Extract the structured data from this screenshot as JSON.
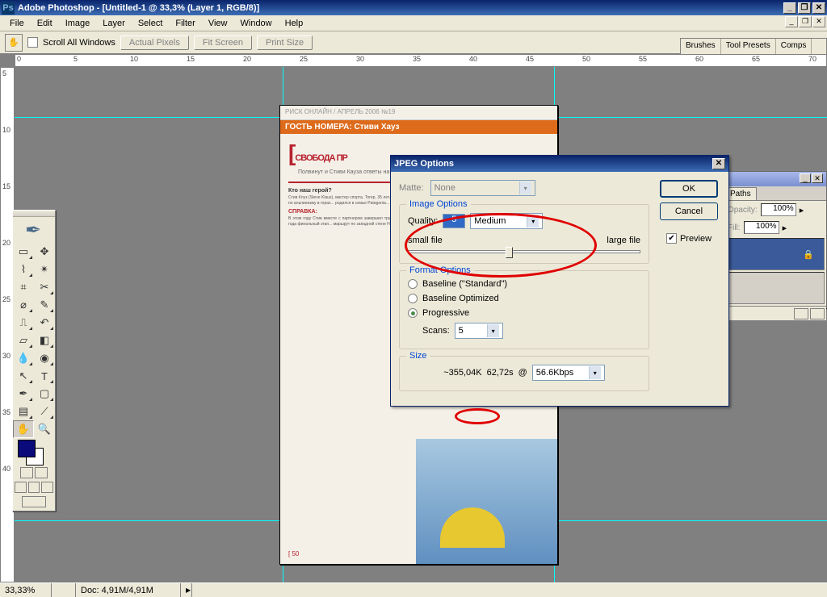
{
  "titlebar": {
    "app_icon_letter": "Ps",
    "title": "Adobe Photoshop - [Untitled-1 @ 33,3% (Layer 1, RGB/8)]"
  },
  "menu": [
    "File",
    "Edit",
    "Image",
    "Layer",
    "Select",
    "Filter",
    "View",
    "Window",
    "Help"
  ],
  "options": {
    "scroll_all": "Scroll All Windows",
    "actual_pixels": "Actual Pixels",
    "fit_screen": "Fit Screen",
    "print_size": "Print Size"
  },
  "ruler_h": [
    "0",
    "5",
    "10",
    "15",
    "20",
    "25",
    "30",
    "35",
    "40",
    "45",
    "50",
    "55",
    "60",
    "65",
    "70"
  ],
  "ruler_v": [
    "5",
    "10",
    "15",
    "20",
    "25",
    "30",
    "35",
    "40"
  ],
  "palette_well": [
    "Brushes",
    "Tool Presets",
    "Comps"
  ],
  "right_panel": {
    "tab": "Paths",
    "opacity_label": "Opacity:",
    "opacity_value": "100%",
    "fill_label": "Fill:",
    "fill_value": "100%"
  },
  "document": {
    "header": "РИСК ОНЛАЙН / АПРЕЛЬ 2006 №19",
    "section": "ГОСТЬ НОМЕРА: Стиви Хауз",
    "title": "СВОБОДА ПР",
    "subtitle": "Полвинут и Стиви Кауза ответы на вопросы...",
    "who_heading": "Кто наш герой?",
    "ref_heading": "СПРАВКА:",
    "footer": "[ 50"
  },
  "dialog": {
    "title": "JPEG Options",
    "ok": "OK",
    "cancel": "Cancel",
    "preview": "Preview",
    "matte_label": "Matte:",
    "matte_value": "None",
    "image_options": "Image Options",
    "quality_label": "Quality:",
    "quality_value": "5",
    "quality_preset": "Medium",
    "small_file": "small file",
    "large_file": "large file",
    "format_options": "Format Options",
    "baseline_standard": "Baseline (\"Standard\")",
    "baseline_optimized": "Baseline Optimized",
    "progressive": "Progressive",
    "scans_label": "Scans:",
    "scans_value": "5",
    "size_legend": "Size",
    "size_est": "~355,04K",
    "size_time": "62,72s",
    "size_at": "@",
    "size_speed": "56.6Kbps"
  },
  "status": {
    "zoom": "33,33%",
    "doc": "Doc: 4,91M/4,91M"
  }
}
